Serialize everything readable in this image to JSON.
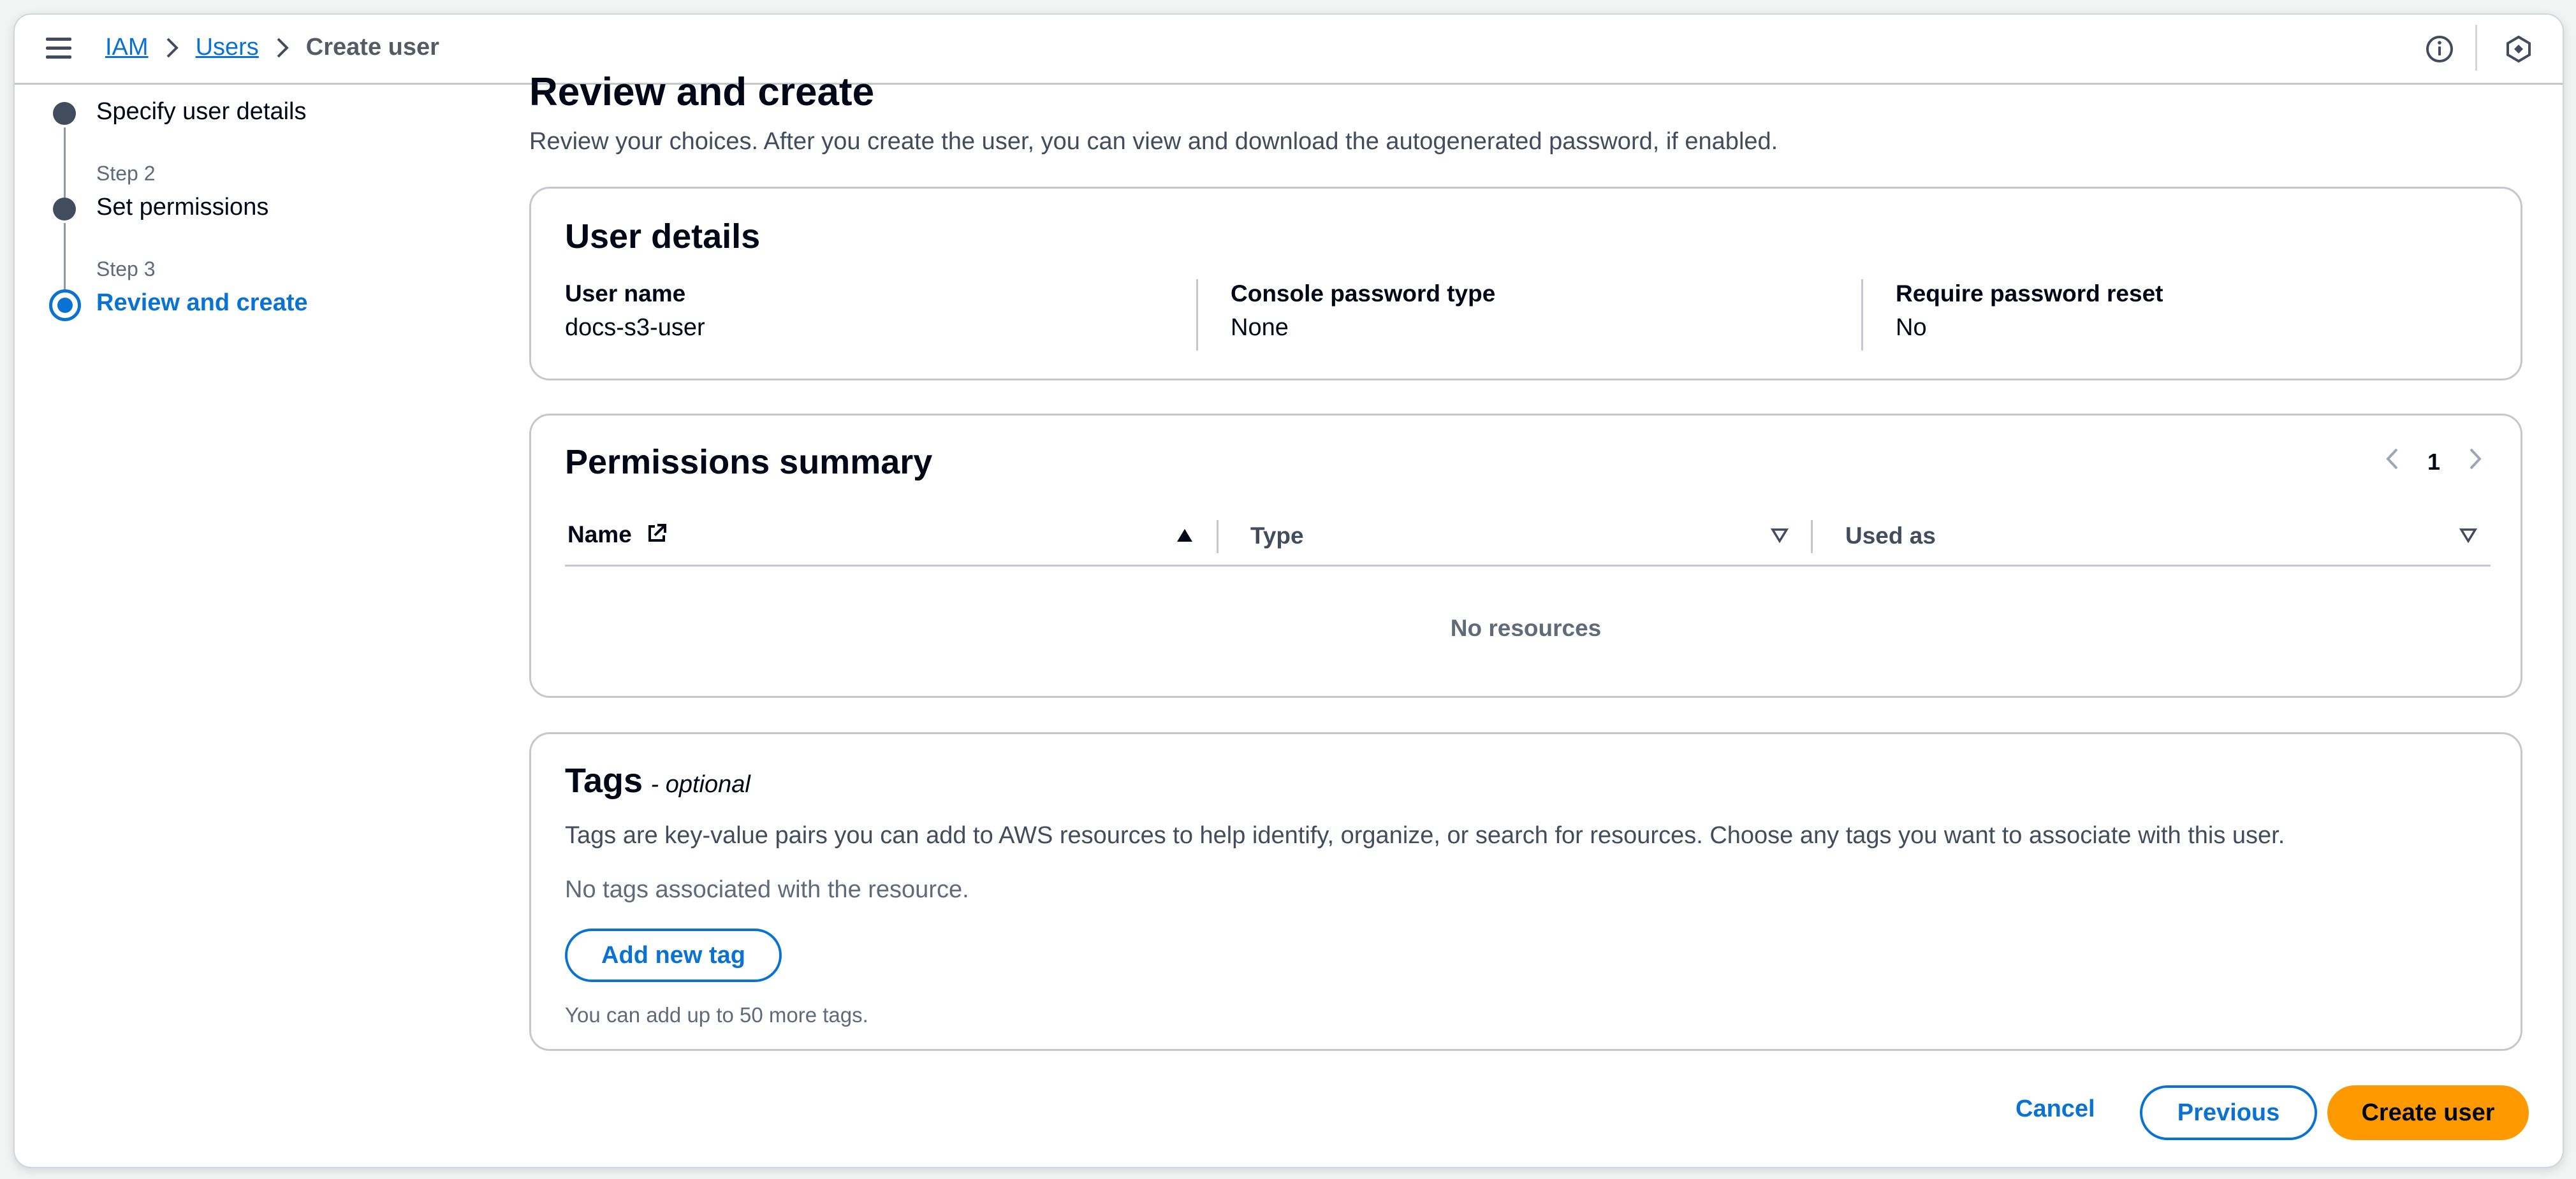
{
  "breadcrumb": {
    "items": [
      "IAM",
      "Users"
    ],
    "current": "Create user"
  },
  "steps": {
    "step1_title": "Specify user details",
    "step2_kicker": "Step 2",
    "step2_title": "Set permissions",
    "step3_kicker": "Step 3",
    "step3_title": "Review and create"
  },
  "main": {
    "title": "Review and create",
    "description": "Review your choices. After you create the user, you can view and download the autogenerated password, if enabled."
  },
  "user_details": {
    "title": "User details",
    "fields": [
      {
        "label": "User name",
        "value": "docs-s3-user"
      },
      {
        "label": "Console password type",
        "value": "None"
      },
      {
        "label": "Require password reset",
        "value": "No"
      }
    ]
  },
  "permissions": {
    "title": "Permissions summary",
    "page": "1",
    "columns": [
      "Name",
      "Type",
      "Used as"
    ],
    "empty_text": "No resources"
  },
  "tags": {
    "title": "Tags",
    "optional": "- optional",
    "description": "Tags are key-value pairs you can add to AWS resources to help identify, organize, or search for resources. Choose any tags you want to associate with this user.",
    "empty_text": "No tags associated with the resource.",
    "add_button": "Add new tag",
    "hint": "You can add up to 50 more tags."
  },
  "footer": {
    "cancel": "Cancel",
    "previous": "Previous",
    "create": "Create user"
  },
  "colors": {
    "link": "#0972d3",
    "primary_button": "#ff9900",
    "text": "#000716"
  }
}
